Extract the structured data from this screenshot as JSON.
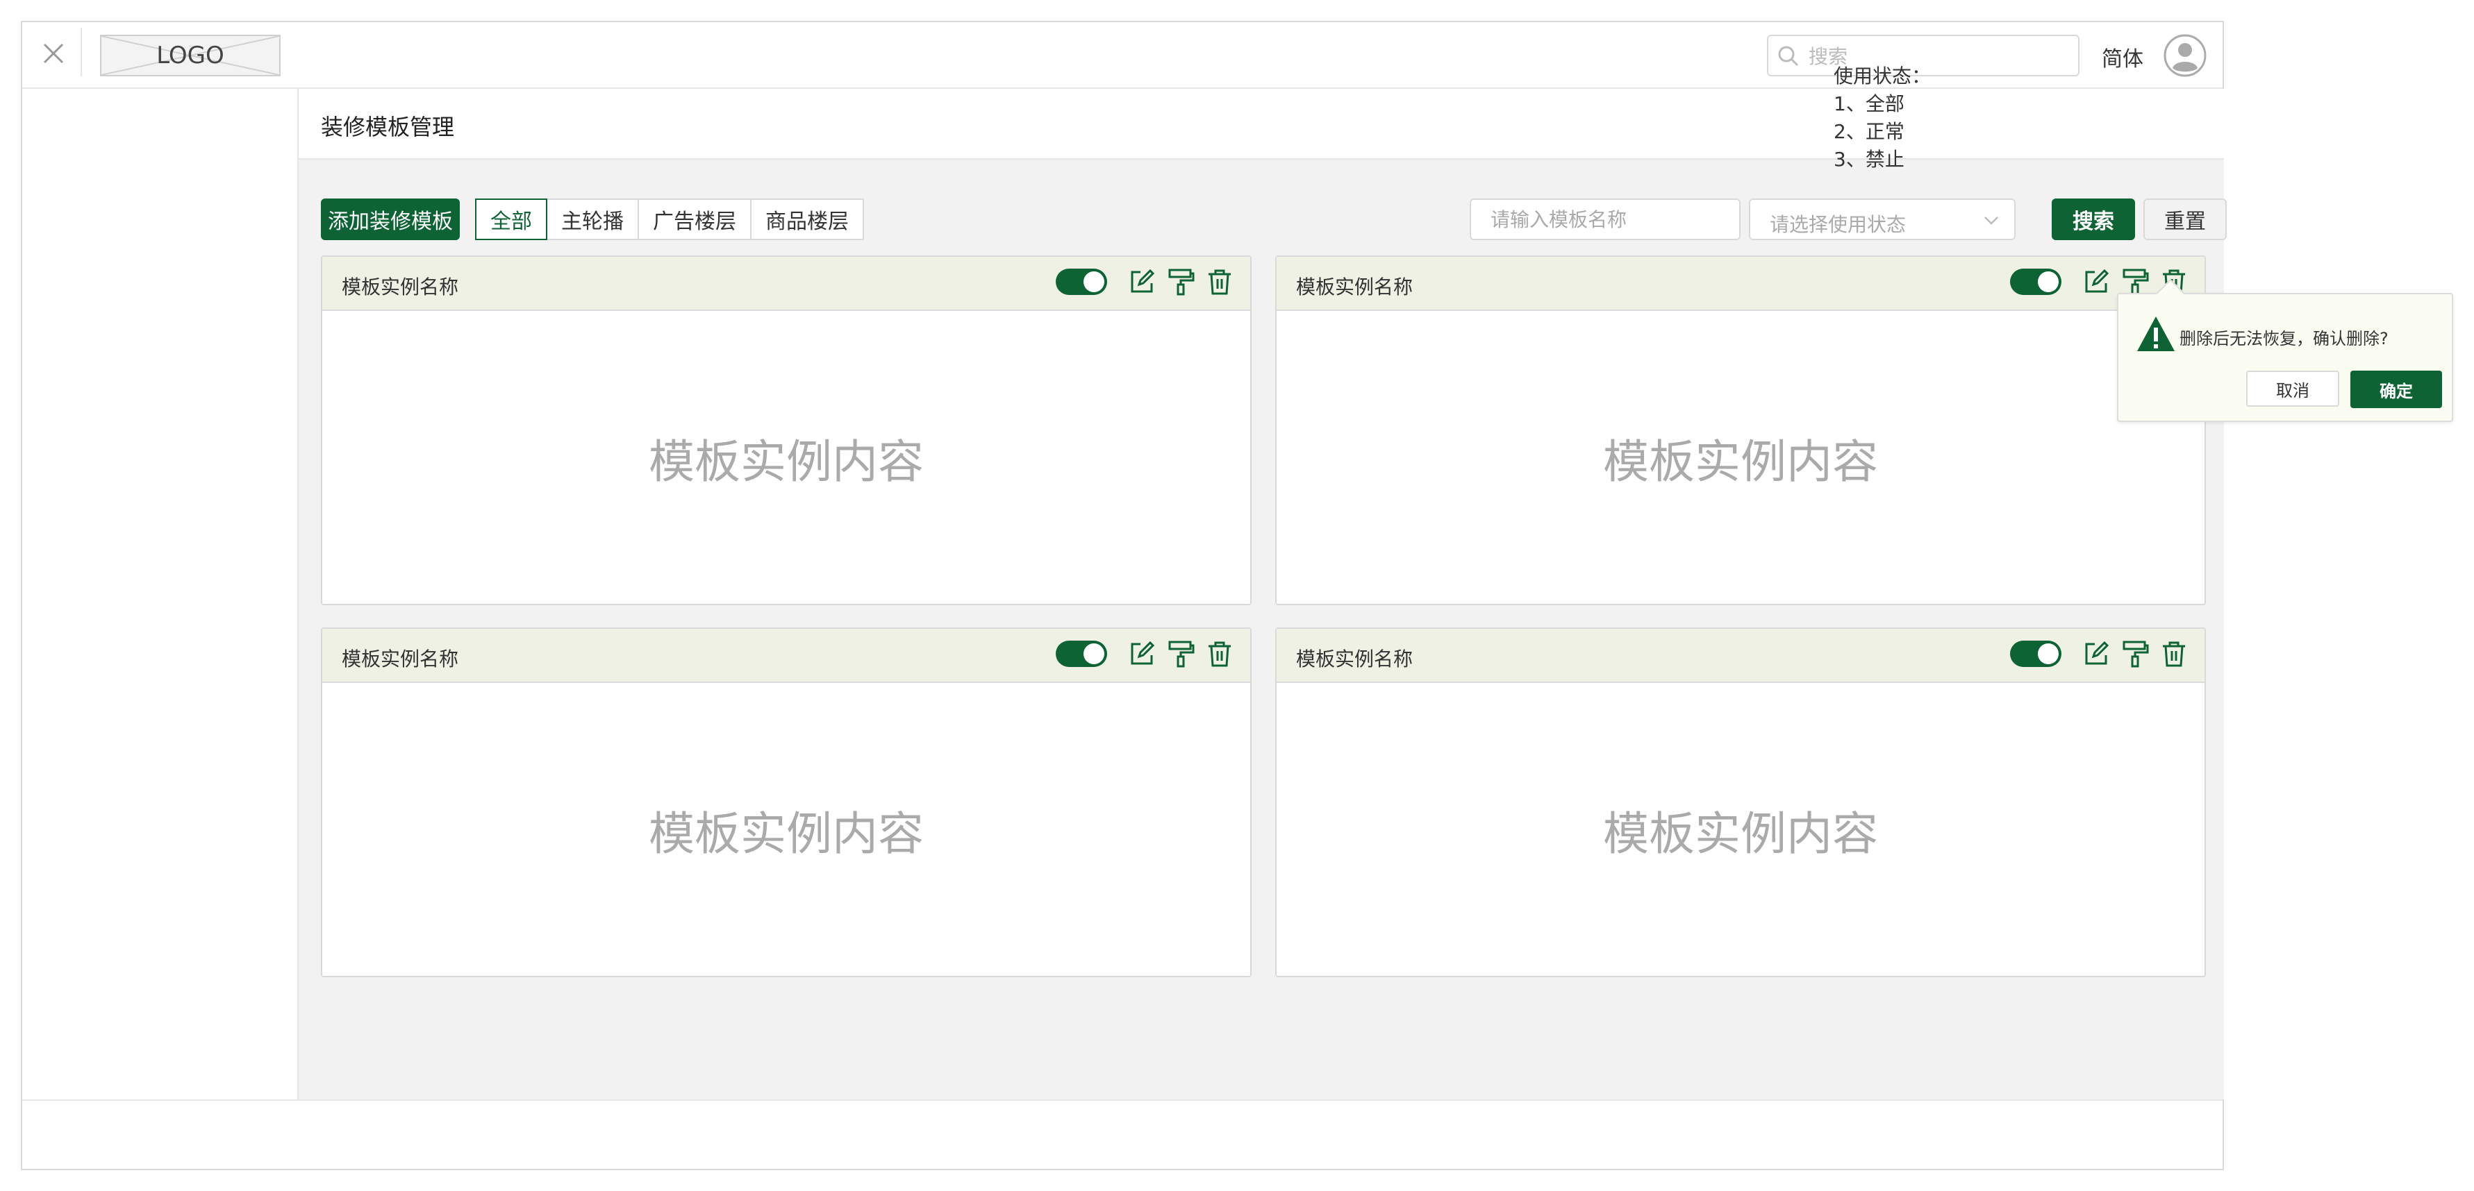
{
  "header": {
    "logo_text": "LOGO",
    "search_placeholder": "搜索",
    "language": "简体"
  },
  "page": {
    "title": "装修模板管理"
  },
  "toolbar": {
    "add_button": "添加装修模板",
    "tabs": [
      {
        "label": "全部",
        "active": true
      },
      {
        "label": "主轮播",
        "active": false
      },
      {
        "label": "广告楼层",
        "active": false
      },
      {
        "label": "商品楼层",
        "active": false
      }
    ],
    "name_input_placeholder": "请输入模板名称",
    "status_select_placeholder": "请选择使用状态",
    "search_button": "搜索",
    "reset_button": "重置"
  },
  "status_note": "使用状态：\n1、全部\n2、正常\n3、禁止",
  "cards": [
    {
      "name": "模板实例名称",
      "content": "模板实例内容",
      "enabled": true
    },
    {
      "name": "模板实例名称",
      "content": "模板实例内容",
      "enabled": true
    },
    {
      "name": "模板实例名称",
      "content": "模板实例内容",
      "enabled": true
    },
    {
      "name": "模板实例名称",
      "content": "模板实例内容",
      "enabled": true
    }
  ],
  "delete_popover": {
    "message": "删除后无法恢复，确认删除?",
    "cancel": "取消",
    "confirm": "确定"
  },
  "colors": {
    "primary": "#0e6335",
    "card_header": "#eef1e4",
    "popover_bg": "#fbfdf3"
  }
}
